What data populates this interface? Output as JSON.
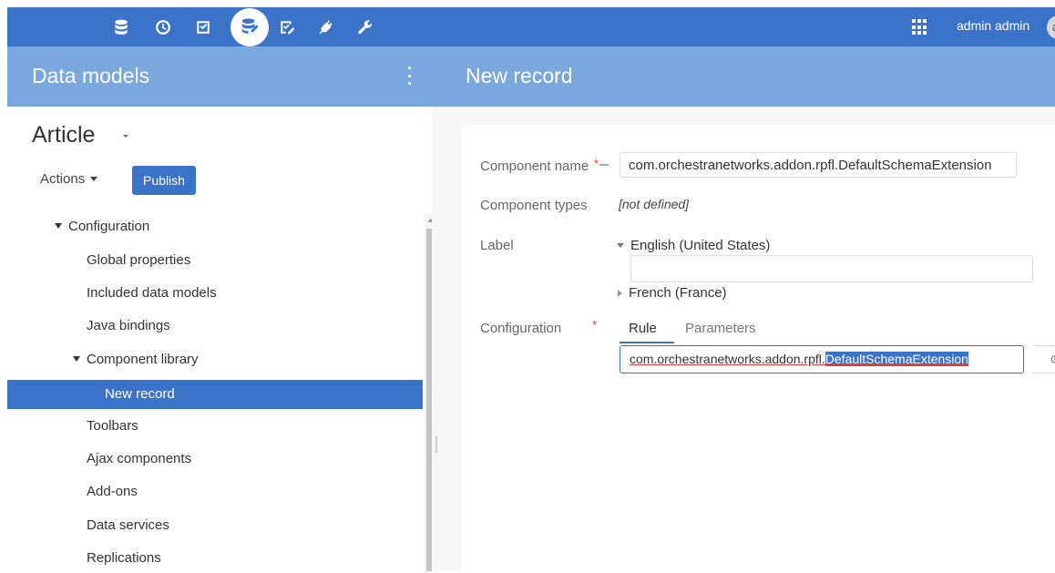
{
  "topbar": {
    "icons": [
      "database-icon",
      "clock-icon",
      "checkbox-icon",
      "data-model-icon",
      "edit-check-icon",
      "plug-icon",
      "wrench-icon"
    ],
    "user_name": "admin admin",
    "avatar_initials": "ad",
    "color": "#3a73c8"
  },
  "header": {
    "left_title": "Data models",
    "right_title": "New record",
    "color": "#7aa7de"
  },
  "left": {
    "title": "Article",
    "actions_label": "Actions",
    "publish_label": "Publish",
    "tree": [
      "Configuration",
      "Global properties",
      "Included data models",
      "Java bindings",
      "Component library",
      "New record",
      "Toolbars",
      "Ajax components",
      "Add-ons",
      "Data services",
      "Replications"
    ]
  },
  "form": {
    "component_name_label": "Component name",
    "component_name_value": "com.orchestranetworks.addon.rpfl.DefaultSchemaExtension",
    "component_types_label": "Component types",
    "component_types_value": "[not defined]",
    "label_label": "Label",
    "lang_english": "English (United States)",
    "lang_french": "French (France)",
    "configuration_label": "Configuration",
    "required_marker": "*",
    "tab_rule": "Rule",
    "tab_parameters": "Parameters",
    "rule_value_prefix": "com.orchestranetworks.addon.rpfl.",
    "rule_value_selected": "DefaultSchemaExtension"
  }
}
